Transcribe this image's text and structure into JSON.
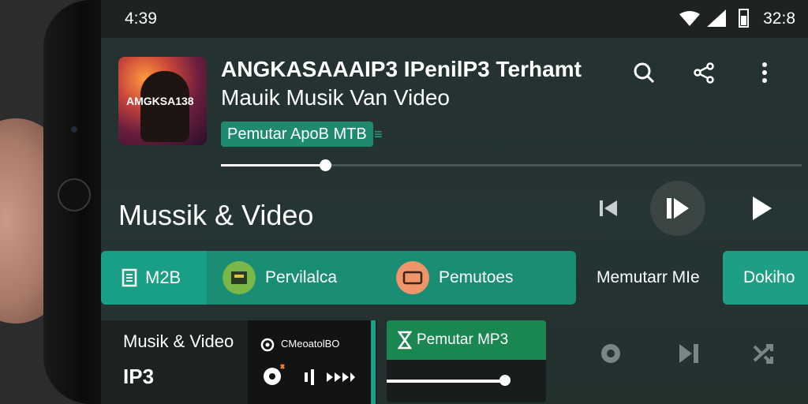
{
  "status_bar": {
    "time_left": "4:39",
    "time_right": "32:8"
  },
  "now_playing": {
    "album_art_text": "AMGKSA138",
    "title_line1": "ANGKASAAAIP3 IPenilP3 Terhamt",
    "title_line2": "Mauik Musik Van Video",
    "chip_label": "Pemutar ApoB MTB",
    "progress": 0.18
  },
  "header_icons": [
    "search-icon",
    "share-icon",
    "more-vert-icon"
  ],
  "section": {
    "title": "Mussik & Video"
  },
  "transport": [
    "skip-previous-icon",
    "play-pause-icon",
    "play-icon"
  ],
  "tabs": {
    "m2b": {
      "label": "M2B",
      "icon": "document-icon"
    },
    "pervilalca": {
      "label": "Pervilalca",
      "icon": "screen-icon",
      "color": "#7ab648"
    },
    "pemutoes": {
      "label": "Pemutoes",
      "icon": "tv-icon",
      "color": "#f0956a"
    },
    "memutar": {
      "label": "Memutarr MIe"
    },
    "dokiho": {
      "label": "Dokiho"
    }
  },
  "cards": {
    "music_video": {
      "title": "Musik & Video",
      "subtitle": "IP3"
    },
    "inner": {
      "label": "CMeoatolBO"
    },
    "player": {
      "label": "Pemutar MP3",
      "progress": 0.79
    }
  },
  "colors": {
    "accent": "#1f9e86",
    "accent_dark": "#1a8d75",
    "green_card": "#1a8751"
  }
}
